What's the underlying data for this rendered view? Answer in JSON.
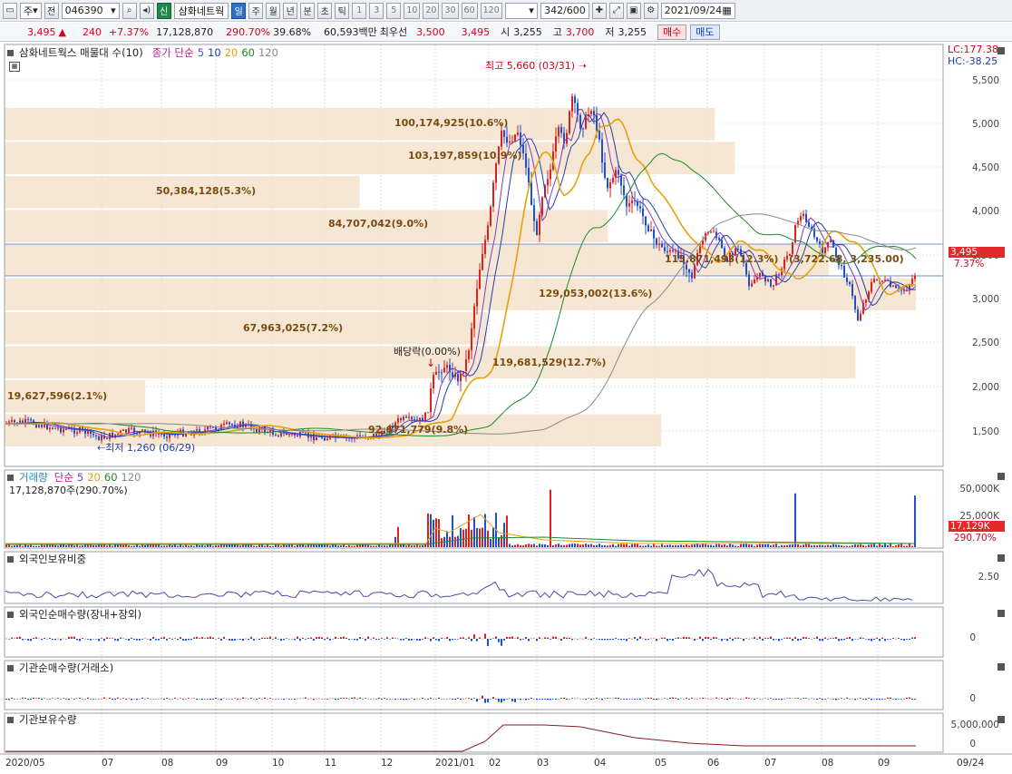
{
  "toolbar": {
    "menu_icon": "window-menu-icon",
    "market": "주",
    "prev": "전",
    "code": "046390",
    "stock_name": "삼화네트웍",
    "badge": "신",
    "period_tabs": [
      "일",
      "주",
      "월",
      "년",
      "분",
      "초",
      "틱"
    ],
    "active_tab": "일",
    "numbers": [
      "1",
      "3",
      "5",
      "10",
      "20",
      "30",
      "60",
      "120"
    ],
    "count": "342",
    "count_total": "/600",
    "date": "2021/09/24"
  },
  "infobar": {
    "price": "3,495",
    "arrow": "▲",
    "change": "240",
    "change_pct": "+7.37%",
    "volume": "17,128,870",
    "volume_ratio": "290.70%",
    "turnover": "39.68%",
    "amount": "60,593백만",
    "best_label": "최우선",
    "best_ask": "3,500",
    "best_bid": "3,495",
    "open_label": "시",
    "open": "3,255",
    "high_label": "고",
    "high": "3,700",
    "low_label": "저",
    "low": "3,255",
    "buy": "매수",
    "sell": "매도"
  },
  "price_panel": {
    "title": "삼화네트웍스 매물대 수(10)",
    "ma_label": "종가 단순",
    "ma_periods": [
      "5",
      "10",
      "20",
      "60",
      "120"
    ],
    "lc": "LC:177.38",
    "hc": "HC:-38.25",
    "high_marker": "최고 5,660 (03/31)",
    "low_marker": "최저 1,260 (06/29)",
    "dividend": "배당락(0.00%)",
    "current_badge": "3,495",
    "current_pct": "7.37%",
    "y_ticks": [
      "5,500",
      "5,000",
      "4,500",
      "4,000",
      "3,500",
      "3,000",
      "2,500",
      "2,000",
      "1,500"
    ],
    "volume_profile": [
      {
        "label": "100,174,925(10.6%)",
        "share": 10.6
      },
      {
        "label": "103,197,859(10.9%)",
        "share": 10.9
      },
      {
        "label": "50,384,128(5.3%)",
        "share": 5.3
      },
      {
        "label": "84,707,042(9.0%)",
        "share": 9.0
      },
      {
        "label": "115,871,493(12.3%)",
        "share": 12.3
      },
      {
        "label": "129,053,002(13.6%)",
        "share": 13.6
      },
      {
        "label": "67,963,025(7.2%)",
        "share": 7.2
      },
      {
        "label": "119,681,529(12.7%)",
        "share": 12.7
      },
      {
        "label": "19,627,596(2.1%)",
        "share": 2.1
      },
      {
        "label": "92,671,779(9.8%)",
        "share": 9.8
      }
    ],
    "vp_overlap": "(3,722.68, 3,235.00)"
  },
  "volume_panel": {
    "title": "거래량",
    "ma_label": "단순",
    "ma_periods": [
      "5",
      "20",
      "60",
      "120"
    ],
    "current": "17,128,870주(290.70%)",
    "y_ticks": [
      "50,000K",
      "25,000K"
    ],
    "badge": "17,129K",
    "badge_pct": "290.70%"
  },
  "foreign_ratio_panel": {
    "title": "외국인보유비중",
    "y_tick": "2.50"
  },
  "foreign_net_panel": {
    "title": "외국인순매수량(장내+장외)",
    "y_tick": "0"
  },
  "inst_net_panel": {
    "title": "기관순매수량(거래소)",
    "y_tick": "0"
  },
  "inst_hold_panel": {
    "title": "기관보유수량",
    "y_ticks": [
      "5,000,000",
      "0"
    ]
  },
  "x_axis": [
    "2020/05",
    "07",
    "08",
    "09",
    "10",
    "11",
    "12",
    "2021/01",
    "02",
    "03",
    "04",
    "05",
    "06",
    "07",
    "08",
    "09",
    "09/24"
  ],
  "colors": {
    "up": "#e0201c",
    "down": "#1f4fd0",
    "vp": "#f3e3cc",
    "ma5": "#7a3fc0",
    "ma10": "#1f3fb0",
    "ma20": "#e6a10a",
    "ma60": "#1c8a2a",
    "ma120": "#888888"
  }
}
